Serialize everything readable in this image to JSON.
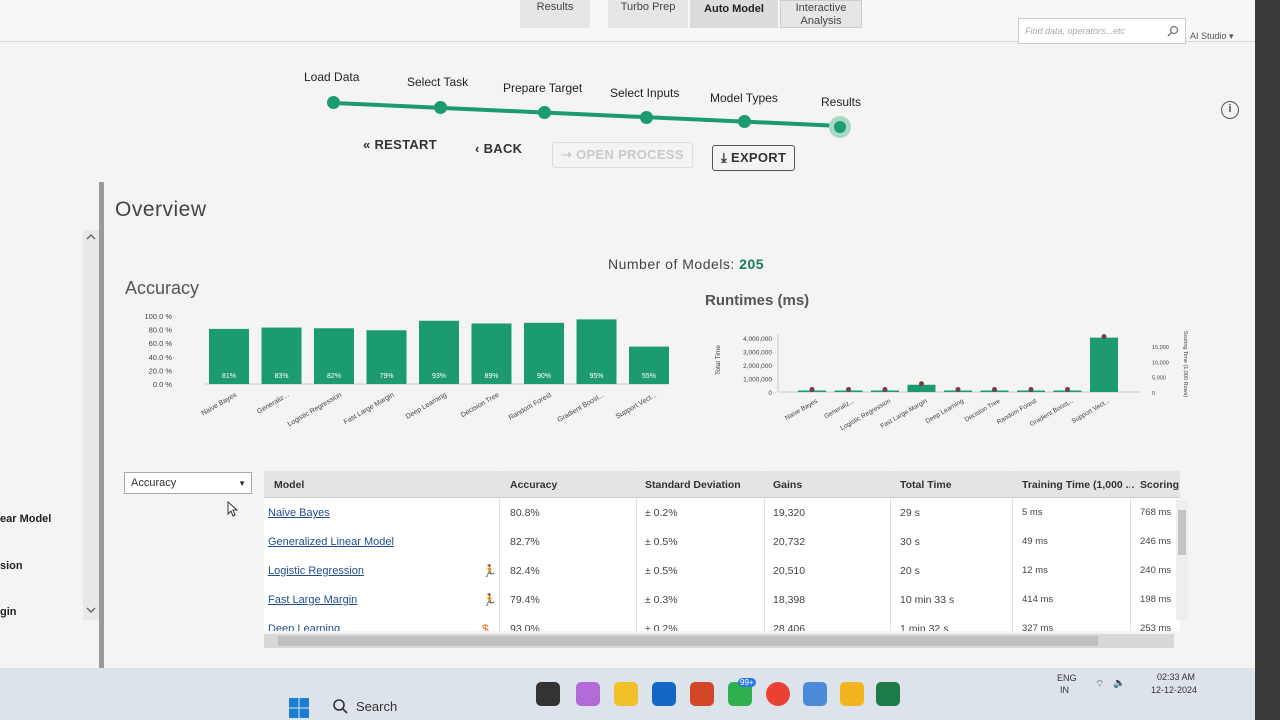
{
  "topnav": {
    "results": "Results",
    "turbo_prep": "Turbo Prep",
    "auto_model": "Auto Model",
    "interactive_analysis": "Interactive Analysis",
    "search_placeholder": "Find data, operators...etc",
    "studio": "AI Studio ▾"
  },
  "stepper": {
    "steps": [
      "Load Data",
      "Select Task",
      "Prepare Target",
      "Select Inputs",
      "Model Types",
      "Results"
    ],
    "current": "Results"
  },
  "actions": {
    "restart": "RESTART",
    "back": "BACK",
    "open_process": "OPEN PROCESS",
    "export": "EXPORT"
  },
  "sidebar": {
    "items": [
      "ear Model",
      "sion",
      "gin"
    ]
  },
  "overview": {
    "title": "Overview",
    "num_models_label": "Number of Models:",
    "num_models_value": "205",
    "accuracy_title": "Accuracy",
    "runtimes_title": "Runtimes (ms)"
  },
  "chart_data": [
    {
      "type": "bar",
      "title": "Accuracy",
      "categories": [
        "Naive Bayes",
        "Generaliz...",
        "Logistic Regression",
        "Fast Large Margin",
        "Deep Learning",
        "Decision Tree",
        "Random Forest",
        "Gradient Boost...",
        "Support Vect..."
      ],
      "values": [
        81,
        83,
        82,
        79,
        93,
        89,
        90,
        95,
        55
      ],
      "data_labels": [
        "81%",
        "83%",
        "82%",
        "79%",
        "93%",
        "89%",
        "90%",
        "95%",
        "55%"
      ],
      "yticks": [
        "100.0 %",
        "80.0 %",
        "60.0 %",
        "40.0 %",
        "20.0 %",
        "0.0 %"
      ],
      "ylim": [
        0,
        100
      ],
      "color": "#1c9a72"
    },
    {
      "type": "bar",
      "title": "Runtimes (ms)",
      "categories": [
        "Naive Bayes",
        "Generaliz...",
        "Logistic Regression",
        "Fast Large Margin",
        "Deep Learning",
        "Decision Tree",
        "Random Forest",
        "Gradient Boost...",
        "Support Vect..."
      ],
      "series": [
        {
          "values": [
            20000,
            20000,
            20000,
            600000,
            20000,
            20000,
            60000,
            20000,
            4500000
          ]
        }
      ],
      "ylabel": "Total Time",
      "ylabel_right": "Scoring Time (1,000 Rows)",
      "yticks": [
        "4,000,000",
        "3,000,000",
        "2,000,000",
        "1,000,000",
        "0"
      ],
      "yticks_right": [
        "15,000",
        "10,000",
        "5,000",
        "0"
      ],
      "ylim": [
        0,
        4800000
      ],
      "color": "#1c9a72"
    }
  ],
  "table": {
    "selector": "Accuracy",
    "columns": [
      "Model",
      "Accuracy",
      "Standard Deviation",
      "Gains",
      "Total Time",
      "Training Time (1,000 ...",
      "Scoring"
    ],
    "rows": [
      {
        "model": "Naive Bayes",
        "icon": "",
        "accuracy": "80.8%",
        "std": "± 0.2%",
        "gains": "19,320",
        "total": "29 s",
        "training": "5 ms",
        "scoring": "768 ms"
      },
      {
        "model": "Generalized Linear Model",
        "icon": "",
        "accuracy": "82.7%",
        "std": "± 0.5%",
        "gains": "20,732",
        "total": "30 s",
        "training": "49 ms",
        "scoring": "246 ms"
      },
      {
        "model": "Logistic Regression",
        "icon": "runner",
        "accuracy": "82.4%",
        "std": "± 0.5%",
        "gains": "20,510",
        "total": "20 s",
        "training": "12 ms",
        "scoring": "240 ms"
      },
      {
        "model": "Fast Large Margin",
        "icon": "runner",
        "accuracy": "79.4%",
        "std": "± 0.3%",
        "gains": "18,398",
        "total": "10 min 33 s",
        "training": "414 ms",
        "scoring": "198 ms"
      },
      {
        "model": "Deep Learning",
        "icon": "dollar",
        "accuracy": "93.0%",
        "std": "± 0.2%",
        "gains": "28,406",
        "total": "1 min 32 s",
        "training": "327 ms",
        "scoring": "253 ms"
      }
    ]
  },
  "taskbar": {
    "search": "Search",
    "lang": "ENG",
    "region": "IN",
    "time": "02:33 AM",
    "date": "12-12-2024",
    "badge": "99+"
  },
  "colors": {
    "accent": "#1c9a72",
    "link": "#1f4e8c"
  }
}
